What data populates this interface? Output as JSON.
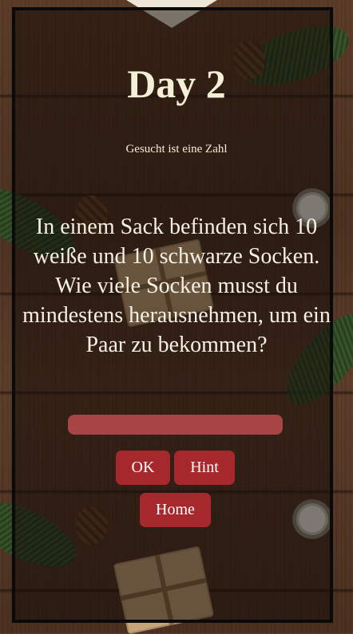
{
  "puzzle": {
    "title": "Day 2",
    "subtitle": "Gesucht ist eine Zahl",
    "question": "In einem Sack befinden sich 10 weiße und 10 schwarze Socken.\nWie viele Socken musst du mindestens herausnehmen, um ein Paar zu bekommen?"
  },
  "answer": {
    "value": "",
    "placeholder": ""
  },
  "buttons": {
    "ok": "OK",
    "hint": "Hint",
    "home": "Home"
  },
  "colors": {
    "button": "#a7282c",
    "input": "#a94444",
    "text": "#f5efd6",
    "panel_border": "#0a0a0a"
  }
}
